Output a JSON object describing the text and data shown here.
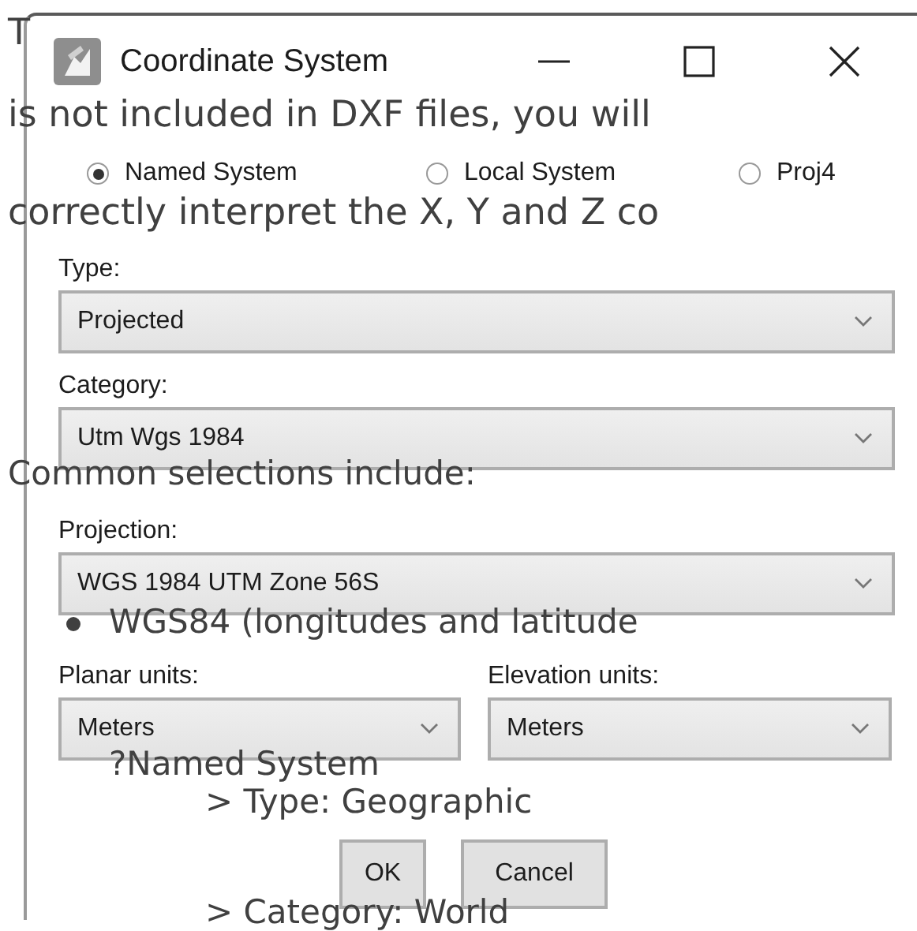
{
  "window": {
    "title": "Coordinate System"
  },
  "system_options": [
    {
      "label": "Named System",
      "selected": true
    },
    {
      "label": "Local System",
      "selected": false
    },
    {
      "label": "Proj4",
      "selected": false
    }
  ],
  "fields": [
    {
      "label": "Type:",
      "value": "Projected"
    },
    {
      "label": "Category:",
      "value": "Utm Wgs 1984"
    },
    {
      "label": "Projection:",
      "value": "WGS 1984 UTM Zone 56S"
    }
  ],
  "units": [
    {
      "label": "Planar units:",
      "value": "Meters"
    },
    {
      "label": "Elevation units:",
      "value": "Meters"
    }
  ],
  "buttons": [
    "OK",
    "Cancel"
  ],
  "document_text": [
    {
      "kind": "line",
      "text": "T"
    },
    {
      "kind": "line",
      "text": "is not included in DXF files, you will"
    },
    {
      "kind": "line",
      "text": "correctly interpret the X, Y and Z co"
    },
    {
      "kind": "line",
      "text": "Common selections include:"
    },
    {
      "kind": "bullet",
      "text": "WGS84 (longitudes and latitude"
    },
    {
      "kind": "sub",
      "text": "?Named System"
    },
    {
      "kind": "step",
      "text": "> Type: Geographic"
    },
    {
      "kind": "step",
      "text": "> Category: World"
    }
  ]
}
